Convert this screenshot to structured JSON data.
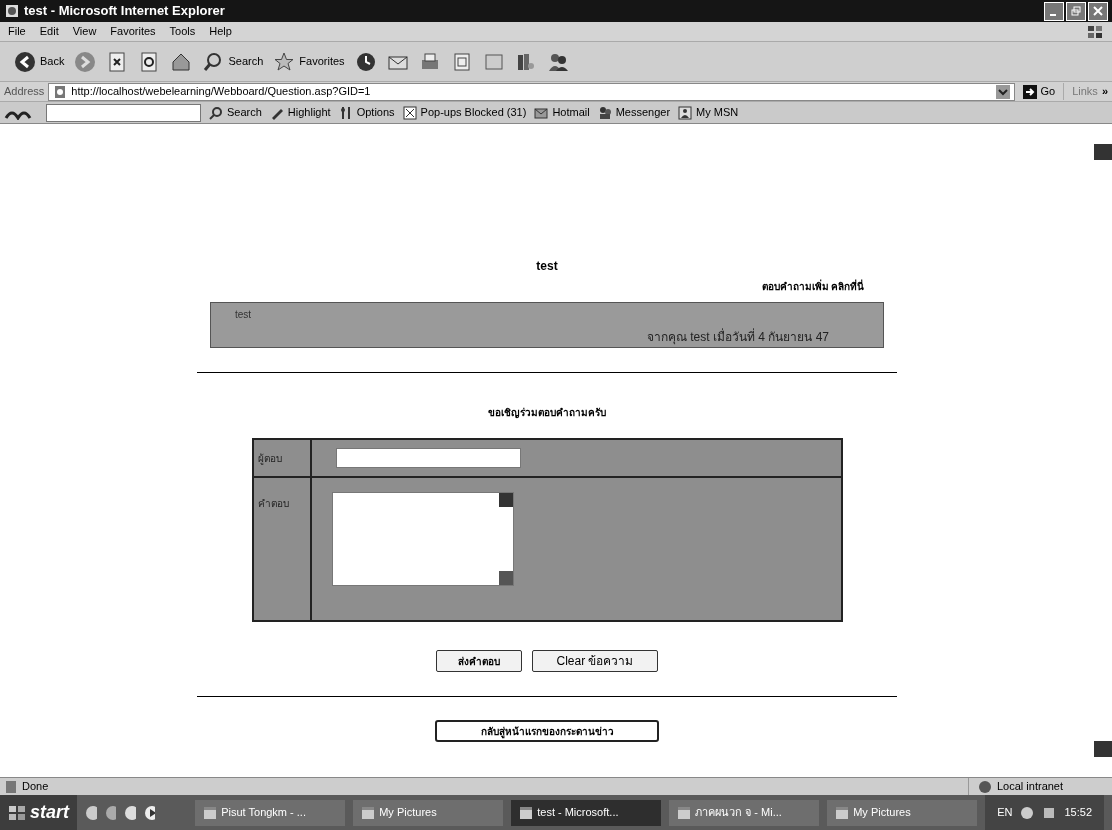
{
  "window": {
    "title": "test - Microsoft Internet Explorer"
  },
  "menu": [
    "File",
    "Edit",
    "View",
    "Favorites",
    "Tools",
    "Help"
  ],
  "toolbar": [
    {
      "kind": "back",
      "label": "Back"
    },
    {
      "kind": "forward"
    },
    {
      "kind": "stop"
    },
    {
      "kind": "refresh"
    },
    {
      "kind": "home"
    },
    {
      "kind": "search",
      "label": "Search"
    },
    {
      "kind": "favorites",
      "label": "Favorites"
    },
    {
      "kind": "history"
    },
    {
      "kind": "mail"
    },
    {
      "kind": "print"
    },
    {
      "kind": "edit"
    },
    {
      "kind": "discuss"
    },
    {
      "kind": "research"
    },
    {
      "kind": "messenger"
    }
  ],
  "address": {
    "label": "Address",
    "url": "http://localhost/webelearning/Webboard/Question.asp?GID=1",
    "go": "Go",
    "links": "Links",
    "more": "»"
  },
  "msn_toolbar": [
    {
      "kind": "search",
      "label": "Search"
    },
    {
      "kind": "highlight",
      "label": "Highlight"
    },
    {
      "kind": "options",
      "label": "Options"
    },
    {
      "kind": "popups",
      "label": "Pop-ups Blocked (31)"
    },
    {
      "kind": "hotmail",
      "label": "Hotmail"
    },
    {
      "kind": "messenger",
      "label": "Messenger"
    },
    {
      "kind": "mymsn",
      "label": "My MSN"
    }
  ],
  "page": {
    "title": "test",
    "reply_link": "ตอบคำถามเพิ่ม คลิกที่นี่",
    "question": {
      "text": "test",
      "meta": "จากคุณ test เมื่อวันที่ 4 กันยายน 47"
    },
    "invite": "ขอเชิญร่วมตอบคำถามครับ",
    "form": {
      "name_label": "ผู้ตอบ",
      "answer_label": "คำตอบ"
    },
    "buttons": [
      "ส่งคำตอบ",
      "Clear ข้อความ"
    ],
    "back_button": "กลับสู่หน้าแรกของกระดานข่าว"
  },
  "status_bar": {
    "text": "Done",
    "zone": "Local intranet"
  },
  "taskbar": {
    "start": "start",
    "tasks": [
      {
        "label": "Pisut Tongkm - ...",
        "selected": false
      },
      {
        "label": "My Pictures",
        "selected": false
      },
      {
        "label": "test - Microsoft...",
        "selected": true
      },
      {
        "label": "ภาคผนวก จ - Mi...",
        "selected": false
      },
      {
        "label": "My Pictures",
        "selected": false
      }
    ],
    "lang": "EN",
    "time": "15:52"
  }
}
